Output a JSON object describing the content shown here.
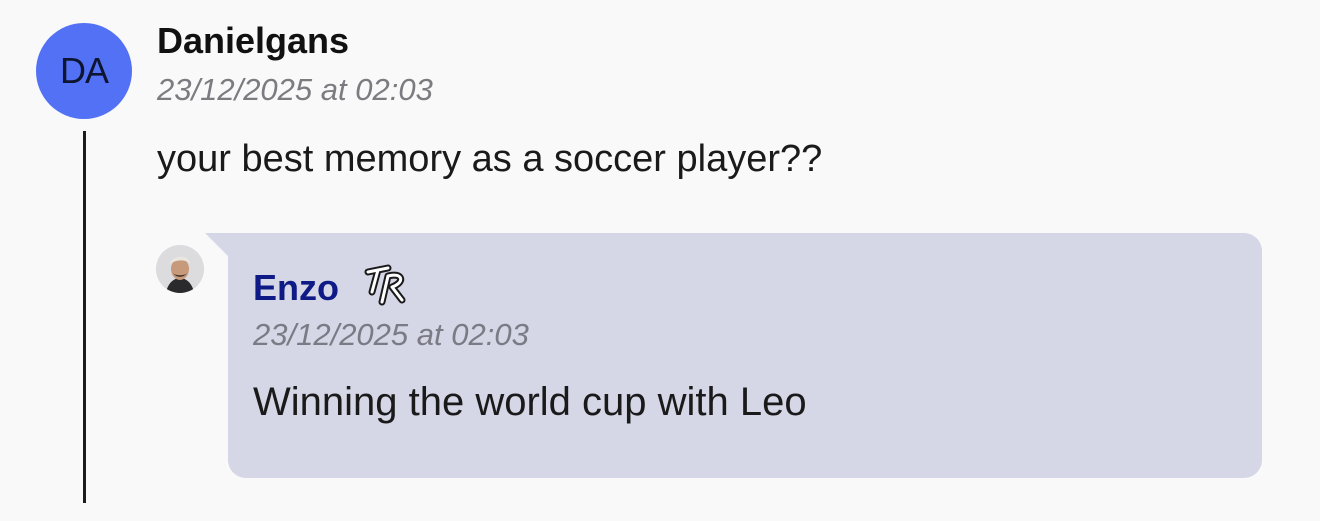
{
  "post": {
    "avatar_initials": "DA",
    "avatar_color": "#5271f4",
    "author": "Danielgans",
    "timestamp": "23/12/2025 at 02:03",
    "message": "your best memory as a soccer player??"
  },
  "reply": {
    "avatar_icon": "profile-photo",
    "author": "Enzo",
    "author_color": "#0e1a86",
    "badge_icon": "tr-badge-icon",
    "timestamp": "23/12/2025 at 02:03",
    "message": "Winning the world cup with Leo",
    "bubble_color": "#d5d6e6"
  }
}
